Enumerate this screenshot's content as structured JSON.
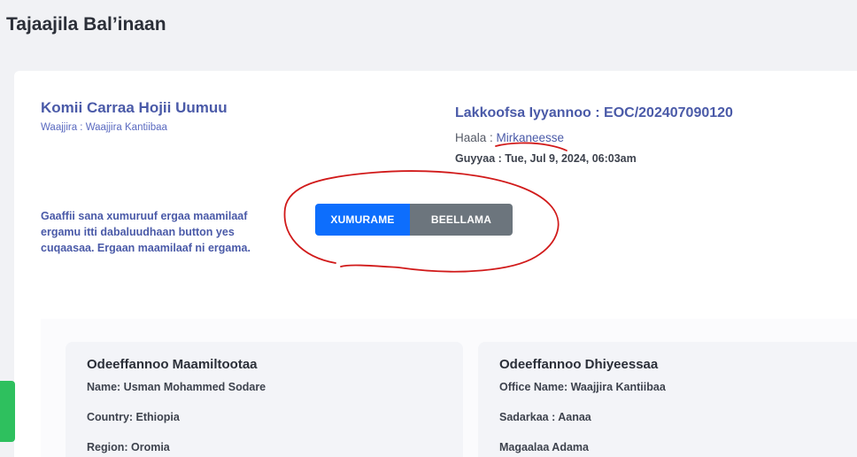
{
  "page": {
    "title": "Tajaajila Bal’inaan"
  },
  "request": {
    "org_name": "Komii Carraa Hojii Uumuu",
    "office_label": "Waajjira : Waajjira Kantiibaa",
    "reference_label": "Lakkoofsa Iyyannoo : EOC/202407090120",
    "status_label": "Haala : ",
    "status_value": "Mirkaneesse",
    "date_label": "Guyyaa : Tue, Jul 9, 2024, 06:03am"
  },
  "instruction": {
    "text": "Gaaffii sana xumuruuf ergaa maamilaaf ergamu itti dabaluudhaan button yes cuqaasaa. Ergaan maamilaaf ni ergama."
  },
  "actions": {
    "accept_label": "XUMURAME",
    "reject_label": "BEELLAMA"
  },
  "customer_info": {
    "title": "Odeeffannoo Maamiltootaa",
    "name": "Name: Usman Mohammed Sodare",
    "country": "Country: Ethiopia",
    "region": "Region: Oromia"
  },
  "provider_info": {
    "title": "Odeeffannoo Dhiyeessaa",
    "office_name": "Office Name: Waajjira Kantiibaa",
    "sector": "Sadarkaa : Aanaa",
    "city": "Magaalaa Adama"
  },
  "colors": {
    "accent": "#4a5aa8",
    "primary_button": "#0d6efd",
    "secondary_button": "#6c757d",
    "annotation": "#d11a1a",
    "side_tab": "#2ec05e"
  }
}
